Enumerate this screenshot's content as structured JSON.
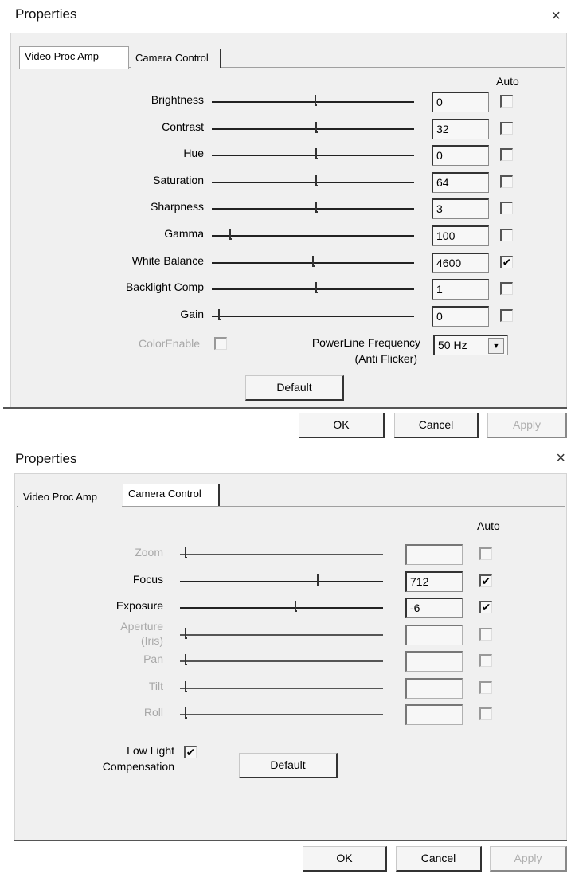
{
  "dialog1": {
    "title": "Properties",
    "close": "×",
    "tabs": [
      "Video Proc Amp",
      "Camera Control"
    ],
    "auto_header": "Auto",
    "rows": [
      {
        "label": "Brightness",
        "value": "0",
        "auto": false
      },
      {
        "label": "Contrast",
        "value": "32",
        "auto": false
      },
      {
        "label": "Hue",
        "value": "0",
        "auto": false
      },
      {
        "label": "Saturation",
        "value": "64",
        "auto": false
      },
      {
        "label": "Sharpness",
        "value": "3",
        "auto": false
      },
      {
        "label": "Gamma",
        "value": "100",
        "auto": false
      },
      {
        "label": "White Balance",
        "value": "4600",
        "auto": true
      },
      {
        "label": "Backlight Comp",
        "value": "1",
        "auto": false
      },
      {
        "label": "Gain",
        "value": "0",
        "auto": false
      }
    ],
    "color_enable": "ColorEnable",
    "powerline_label_1": "PowerLine Frequency",
    "powerline_label_2": "(Anti Flicker)",
    "powerline_value": "50 Hz",
    "default_button": "Default",
    "ok_button": "OK",
    "cancel_button": "Cancel",
    "apply_button": "Apply"
  },
  "dialog2": {
    "title": "Properties",
    "close": "×",
    "tabs": [
      "Video Proc Amp",
      "Camera Control"
    ],
    "auto_header": "Auto",
    "rows": [
      {
        "label": "Zoom",
        "value": "",
        "auto": false,
        "disabled": true
      },
      {
        "label": "Focus",
        "value": "712",
        "auto": true,
        "disabled": false
      },
      {
        "label": "Exposure",
        "value": "-6",
        "auto": true,
        "disabled": false
      },
      {
        "label": "Aperture",
        "label2": "(Iris)",
        "value": "",
        "auto": false,
        "disabled": true
      },
      {
        "label": "Pan",
        "value": "",
        "auto": false,
        "disabled": true
      },
      {
        "label": "Tilt",
        "value": "",
        "auto": false,
        "disabled": true
      },
      {
        "label": "Roll",
        "value": "",
        "auto": false,
        "disabled": true
      }
    ],
    "low_light_1": "Low Light",
    "low_light_2": "Compensation",
    "low_light_checked": true,
    "default_button": "Default",
    "ok_button": "OK",
    "cancel_button": "Cancel",
    "apply_button": "Apply"
  },
  "check_glyph": "✔"
}
